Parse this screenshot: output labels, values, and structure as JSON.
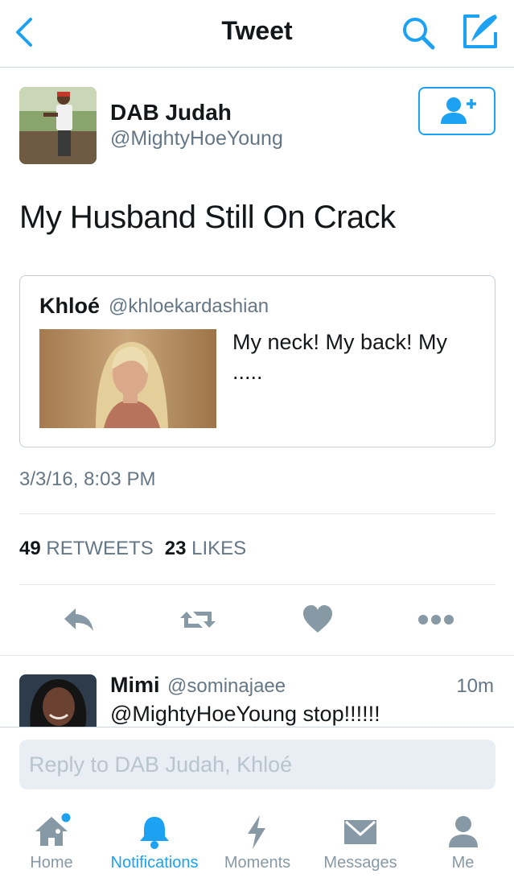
{
  "nav": {
    "title": "Tweet"
  },
  "tweet": {
    "author_name": "DAB Judah",
    "author_handle": "@MightyHoeYoung",
    "text": "My Husband Still On Crack",
    "timestamp": "3/3/16, 8:03 PM",
    "retweets_count": "49",
    "retweets_label": "RETWEETS",
    "likes_count": "23",
    "likes_label": "LIKES"
  },
  "quote": {
    "author_name": "Khloé",
    "author_handle": "@khloekardashian",
    "text": "My neck! My back! My ....."
  },
  "reply": {
    "author_name": "Mimi",
    "author_handle": "@sominajaee",
    "time": "10m",
    "text": "@MightyHoeYoung stop!!!!!!"
  },
  "composer": {
    "placeholder": "Reply to DAB Judah, Khloé"
  },
  "tabs": [
    {
      "label": "Home",
      "icon": "home-icon",
      "has_dot": true
    },
    {
      "label": "Notifications",
      "icon": "bell-icon",
      "active": true
    },
    {
      "label": "Moments",
      "icon": "lightning-icon"
    },
    {
      "label": "Messages",
      "icon": "envelope-icon"
    },
    {
      "label": "Me",
      "icon": "person-icon"
    }
  ],
  "colors": {
    "accent": "#1da1f2",
    "muted": "#657786",
    "icon_gray": "#8899a6",
    "border": "#e1e8ed"
  }
}
